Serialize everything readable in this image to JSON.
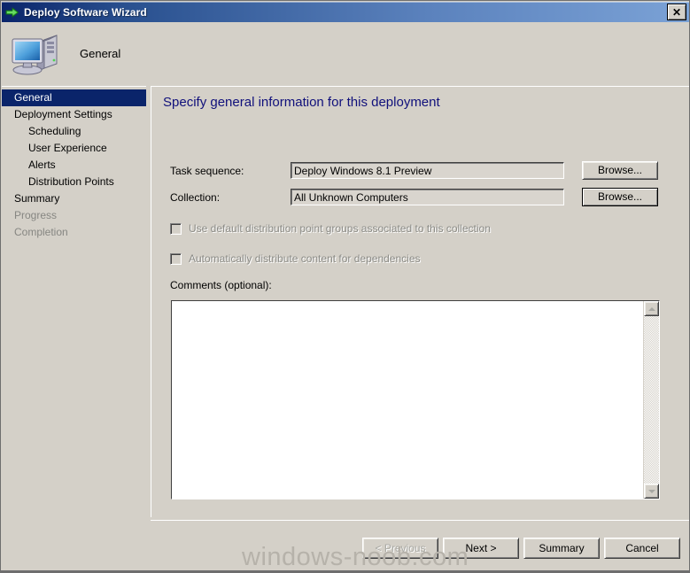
{
  "window": {
    "title": "Deploy Software Wizard",
    "title_icon": "green-right-arrow-icon",
    "close_label": "✕"
  },
  "header": {
    "title": "General",
    "icon": "computer-icon"
  },
  "sidebar": {
    "items": [
      {
        "label": "General",
        "level": 0,
        "state": "selected"
      },
      {
        "label": "Deployment Settings",
        "level": 0,
        "state": "normal"
      },
      {
        "label": "Scheduling",
        "level": 1,
        "state": "normal"
      },
      {
        "label": "User Experience",
        "level": 1,
        "state": "normal"
      },
      {
        "label": "Alerts",
        "level": 1,
        "state": "normal"
      },
      {
        "label": "Distribution Points",
        "level": 1,
        "state": "normal"
      },
      {
        "label": "Summary",
        "level": 0,
        "state": "normal"
      },
      {
        "label": "Progress",
        "level": 0,
        "state": "disabled"
      },
      {
        "label": "Completion",
        "level": 0,
        "state": "disabled"
      }
    ]
  },
  "content": {
    "heading": "Specify general information for this deployment",
    "fields": {
      "task_sequence": {
        "label": "Task sequence:",
        "value": "Deploy Windows 8.1 Preview",
        "browse_label": "Browse..."
      },
      "collection": {
        "label": "Collection:",
        "value": "All Unknown Computers",
        "browse_label": "Browse..."
      }
    },
    "checkboxes": [
      {
        "label": "Use default distribution point groups associated to this collection",
        "checked": false,
        "enabled": false
      },
      {
        "label": "Automatically distribute content for dependencies",
        "checked": false,
        "enabled": false
      }
    ],
    "comments": {
      "label": "Comments (optional):",
      "value": "",
      "placeholder": ""
    }
  },
  "buttons": {
    "previous": {
      "label": "< Previous",
      "enabled": false
    },
    "next": {
      "label": "Next >",
      "enabled": true
    },
    "summary": {
      "label": "Summary",
      "enabled": true
    },
    "cancel": {
      "label": "Cancel",
      "enabled": true
    }
  },
  "watermark": "windows-noob.com",
  "colors": {
    "titlebar_start": "#0a246a",
    "titlebar_end": "#7ba2d6",
    "dialog_face": "#d4d0c8",
    "heading_text": "#10107b",
    "selection": "#0a246a",
    "disabled_text": "#868682"
  }
}
